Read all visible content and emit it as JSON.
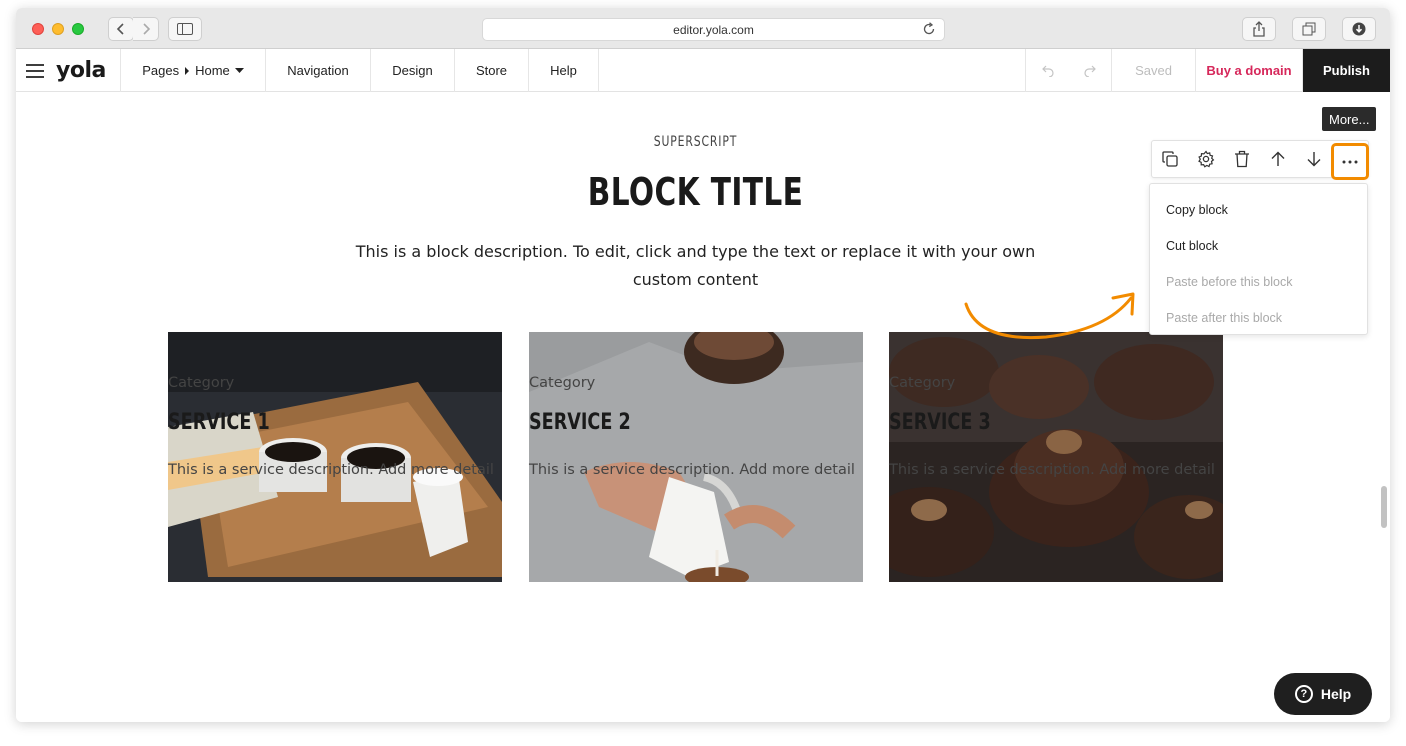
{
  "browser": {
    "url": "editor.yola.com"
  },
  "toolbar": {
    "logo": "yola",
    "pages_label": "Pages",
    "current_page": "Home",
    "navigation": "Navigation",
    "design": "Design",
    "store": "Store",
    "help": "Help",
    "saved": "Saved",
    "buy_domain": "Buy a domain",
    "publish": "Publish"
  },
  "block": {
    "superscript": "SUPERSCRIPT",
    "title": "BLOCK TITLE",
    "description": "This is a block description. To edit, click and type the text or replace it with your own custom content"
  },
  "cards": [
    {
      "category": "Category",
      "title": "SERVICE 1",
      "description": "This is a service description. Add more detail"
    },
    {
      "category": "Category",
      "title": "SERVICE 2",
      "description": "This is a service description. Add more detail"
    },
    {
      "category": "Category",
      "title": "SERVICE 3",
      "description": "This is a service description. Add more detail"
    }
  ],
  "block_tools": {
    "tooltip": "More...",
    "icons": [
      "copy-icon",
      "gear-icon",
      "trash-icon",
      "arrow-up-icon",
      "arrow-down-icon",
      "more-icon"
    ]
  },
  "more_menu": {
    "items": [
      {
        "label": "Copy block",
        "enabled": true
      },
      {
        "label": "Cut block",
        "enabled": true
      },
      {
        "label": "Paste before this block",
        "enabled": false
      },
      {
        "label": "Paste after this block",
        "enabled": false
      }
    ]
  },
  "help_button": {
    "label": "Help"
  },
  "colors": {
    "accent_orange": "#f28b00",
    "buy_domain": "#d6275a",
    "publish_bg": "#1c1c1c"
  }
}
